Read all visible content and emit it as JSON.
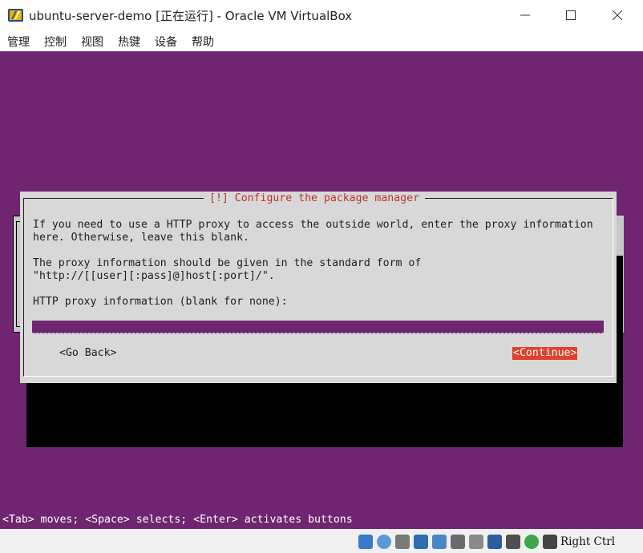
{
  "window": {
    "title": "ubuntu-server-demo [正在运行] - Oracle VM VirtualBox",
    "icon": "virtualbox-icon",
    "controls": [
      "minimize-icon",
      "maximize-icon",
      "close-icon"
    ]
  },
  "menubar": {
    "items": [
      "管理",
      "控制",
      "视图",
      "热键",
      "设备",
      "帮助"
    ]
  },
  "dialog": {
    "title": "[!] Configure the package manager",
    "lines": [
      "If you need to use a HTTP proxy to access the outside world, enter the proxy information",
      "here. Otherwise, leave this blank.",
      "The proxy information should be given in the standard form of",
      "\"http://[[user][:pass]@]host[:port]/\".",
      "HTTP proxy information (blank for none):"
    ],
    "proxy_input": {
      "value": "",
      "placeholder": ""
    },
    "back_button": "<Go Back>",
    "continue_button": "<Continue>"
  },
  "helpline": "<Tab> moves; <Space> selects; <Enter> activates buttons",
  "statusbar": {
    "icons": [
      "hard-disk-icon",
      "optical-drive-icon",
      "audio-icon",
      "network-icon",
      "usb-icon",
      "shared-folders-icon",
      "display-icon",
      "video-capture-icon",
      "recording-icon",
      "cpu-icon",
      "mouse-integration-icon",
      "keyboard-capture-icon"
    ],
    "host_key": "Right Ctrl"
  },
  "colors": {
    "vm_background": "#6f256f",
    "dialog_background": "#d8d8d8",
    "dialog_title": "#c03030",
    "focused_button": "#e0402c"
  }
}
